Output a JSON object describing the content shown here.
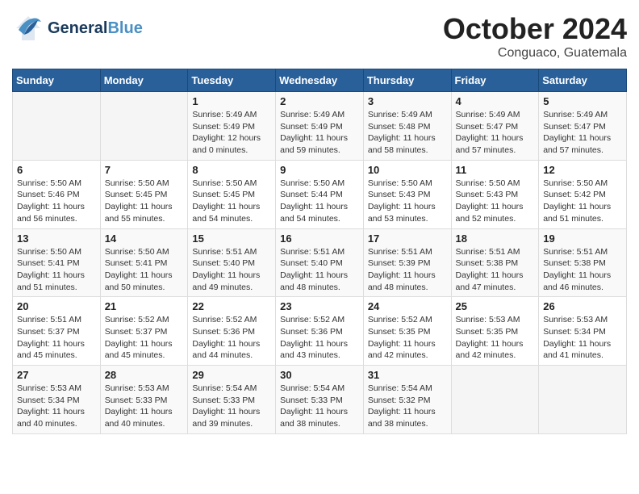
{
  "header": {
    "logo_general": "General",
    "logo_blue": "Blue",
    "month_title": "October 2024",
    "location": "Conguaco, Guatemala"
  },
  "weekdays": [
    "Sunday",
    "Monday",
    "Tuesday",
    "Wednesday",
    "Thursday",
    "Friday",
    "Saturday"
  ],
  "weeks": [
    [
      {
        "day": "",
        "info": ""
      },
      {
        "day": "",
        "info": ""
      },
      {
        "day": "1",
        "info": "Sunrise: 5:49 AM\nSunset: 5:49 PM\nDaylight: 12 hours and 0 minutes."
      },
      {
        "day": "2",
        "info": "Sunrise: 5:49 AM\nSunset: 5:49 PM\nDaylight: 11 hours and 59 minutes."
      },
      {
        "day": "3",
        "info": "Sunrise: 5:49 AM\nSunset: 5:48 PM\nDaylight: 11 hours and 58 minutes."
      },
      {
        "day": "4",
        "info": "Sunrise: 5:49 AM\nSunset: 5:47 PM\nDaylight: 11 hours and 57 minutes."
      },
      {
        "day": "5",
        "info": "Sunrise: 5:49 AM\nSunset: 5:47 PM\nDaylight: 11 hours and 57 minutes."
      }
    ],
    [
      {
        "day": "6",
        "info": "Sunrise: 5:50 AM\nSunset: 5:46 PM\nDaylight: 11 hours and 56 minutes."
      },
      {
        "day": "7",
        "info": "Sunrise: 5:50 AM\nSunset: 5:45 PM\nDaylight: 11 hours and 55 minutes."
      },
      {
        "day": "8",
        "info": "Sunrise: 5:50 AM\nSunset: 5:45 PM\nDaylight: 11 hours and 54 minutes."
      },
      {
        "day": "9",
        "info": "Sunrise: 5:50 AM\nSunset: 5:44 PM\nDaylight: 11 hours and 54 minutes."
      },
      {
        "day": "10",
        "info": "Sunrise: 5:50 AM\nSunset: 5:43 PM\nDaylight: 11 hours and 53 minutes."
      },
      {
        "day": "11",
        "info": "Sunrise: 5:50 AM\nSunset: 5:43 PM\nDaylight: 11 hours and 52 minutes."
      },
      {
        "day": "12",
        "info": "Sunrise: 5:50 AM\nSunset: 5:42 PM\nDaylight: 11 hours and 51 minutes."
      }
    ],
    [
      {
        "day": "13",
        "info": "Sunrise: 5:50 AM\nSunset: 5:41 PM\nDaylight: 11 hours and 51 minutes."
      },
      {
        "day": "14",
        "info": "Sunrise: 5:50 AM\nSunset: 5:41 PM\nDaylight: 11 hours and 50 minutes."
      },
      {
        "day": "15",
        "info": "Sunrise: 5:51 AM\nSunset: 5:40 PM\nDaylight: 11 hours and 49 minutes."
      },
      {
        "day": "16",
        "info": "Sunrise: 5:51 AM\nSunset: 5:40 PM\nDaylight: 11 hours and 48 minutes."
      },
      {
        "day": "17",
        "info": "Sunrise: 5:51 AM\nSunset: 5:39 PM\nDaylight: 11 hours and 48 minutes."
      },
      {
        "day": "18",
        "info": "Sunrise: 5:51 AM\nSunset: 5:38 PM\nDaylight: 11 hours and 47 minutes."
      },
      {
        "day": "19",
        "info": "Sunrise: 5:51 AM\nSunset: 5:38 PM\nDaylight: 11 hours and 46 minutes."
      }
    ],
    [
      {
        "day": "20",
        "info": "Sunrise: 5:51 AM\nSunset: 5:37 PM\nDaylight: 11 hours and 45 minutes."
      },
      {
        "day": "21",
        "info": "Sunrise: 5:52 AM\nSunset: 5:37 PM\nDaylight: 11 hours and 45 minutes."
      },
      {
        "day": "22",
        "info": "Sunrise: 5:52 AM\nSunset: 5:36 PM\nDaylight: 11 hours and 44 minutes."
      },
      {
        "day": "23",
        "info": "Sunrise: 5:52 AM\nSunset: 5:36 PM\nDaylight: 11 hours and 43 minutes."
      },
      {
        "day": "24",
        "info": "Sunrise: 5:52 AM\nSunset: 5:35 PM\nDaylight: 11 hours and 42 minutes."
      },
      {
        "day": "25",
        "info": "Sunrise: 5:53 AM\nSunset: 5:35 PM\nDaylight: 11 hours and 42 minutes."
      },
      {
        "day": "26",
        "info": "Sunrise: 5:53 AM\nSunset: 5:34 PM\nDaylight: 11 hours and 41 minutes."
      }
    ],
    [
      {
        "day": "27",
        "info": "Sunrise: 5:53 AM\nSunset: 5:34 PM\nDaylight: 11 hours and 40 minutes."
      },
      {
        "day": "28",
        "info": "Sunrise: 5:53 AM\nSunset: 5:33 PM\nDaylight: 11 hours and 40 minutes."
      },
      {
        "day": "29",
        "info": "Sunrise: 5:54 AM\nSunset: 5:33 PM\nDaylight: 11 hours and 39 minutes."
      },
      {
        "day": "30",
        "info": "Sunrise: 5:54 AM\nSunset: 5:33 PM\nDaylight: 11 hours and 38 minutes."
      },
      {
        "day": "31",
        "info": "Sunrise: 5:54 AM\nSunset: 5:32 PM\nDaylight: 11 hours and 38 minutes."
      },
      {
        "day": "",
        "info": ""
      },
      {
        "day": "",
        "info": ""
      }
    ]
  ]
}
